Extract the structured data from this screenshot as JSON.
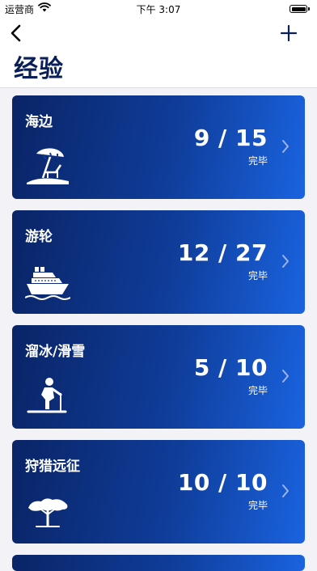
{
  "status_bar": {
    "carrier": "运营商",
    "time": "下午 3:07"
  },
  "nav": {
    "title": "经验"
  },
  "cards": [
    {
      "name": "海边",
      "count": "9 / 15",
      "status": "完毕",
      "icon": "beach-umbrella-icon"
    },
    {
      "name": "游轮",
      "count": "12 / 27",
      "status": "完毕",
      "icon": "cruise-ship-icon"
    },
    {
      "name": "溜冰/滑雪",
      "count": "5 / 10",
      "status": "完毕",
      "icon": "skier-icon"
    },
    {
      "name": "狩猎远征",
      "count": "10 / 10",
      "status": "完毕",
      "icon": "acacia-tree-icon"
    }
  ],
  "colors": {
    "title": "#0a1f57",
    "card_start": "#0a2466",
    "card_end": "#1a63e0"
  }
}
